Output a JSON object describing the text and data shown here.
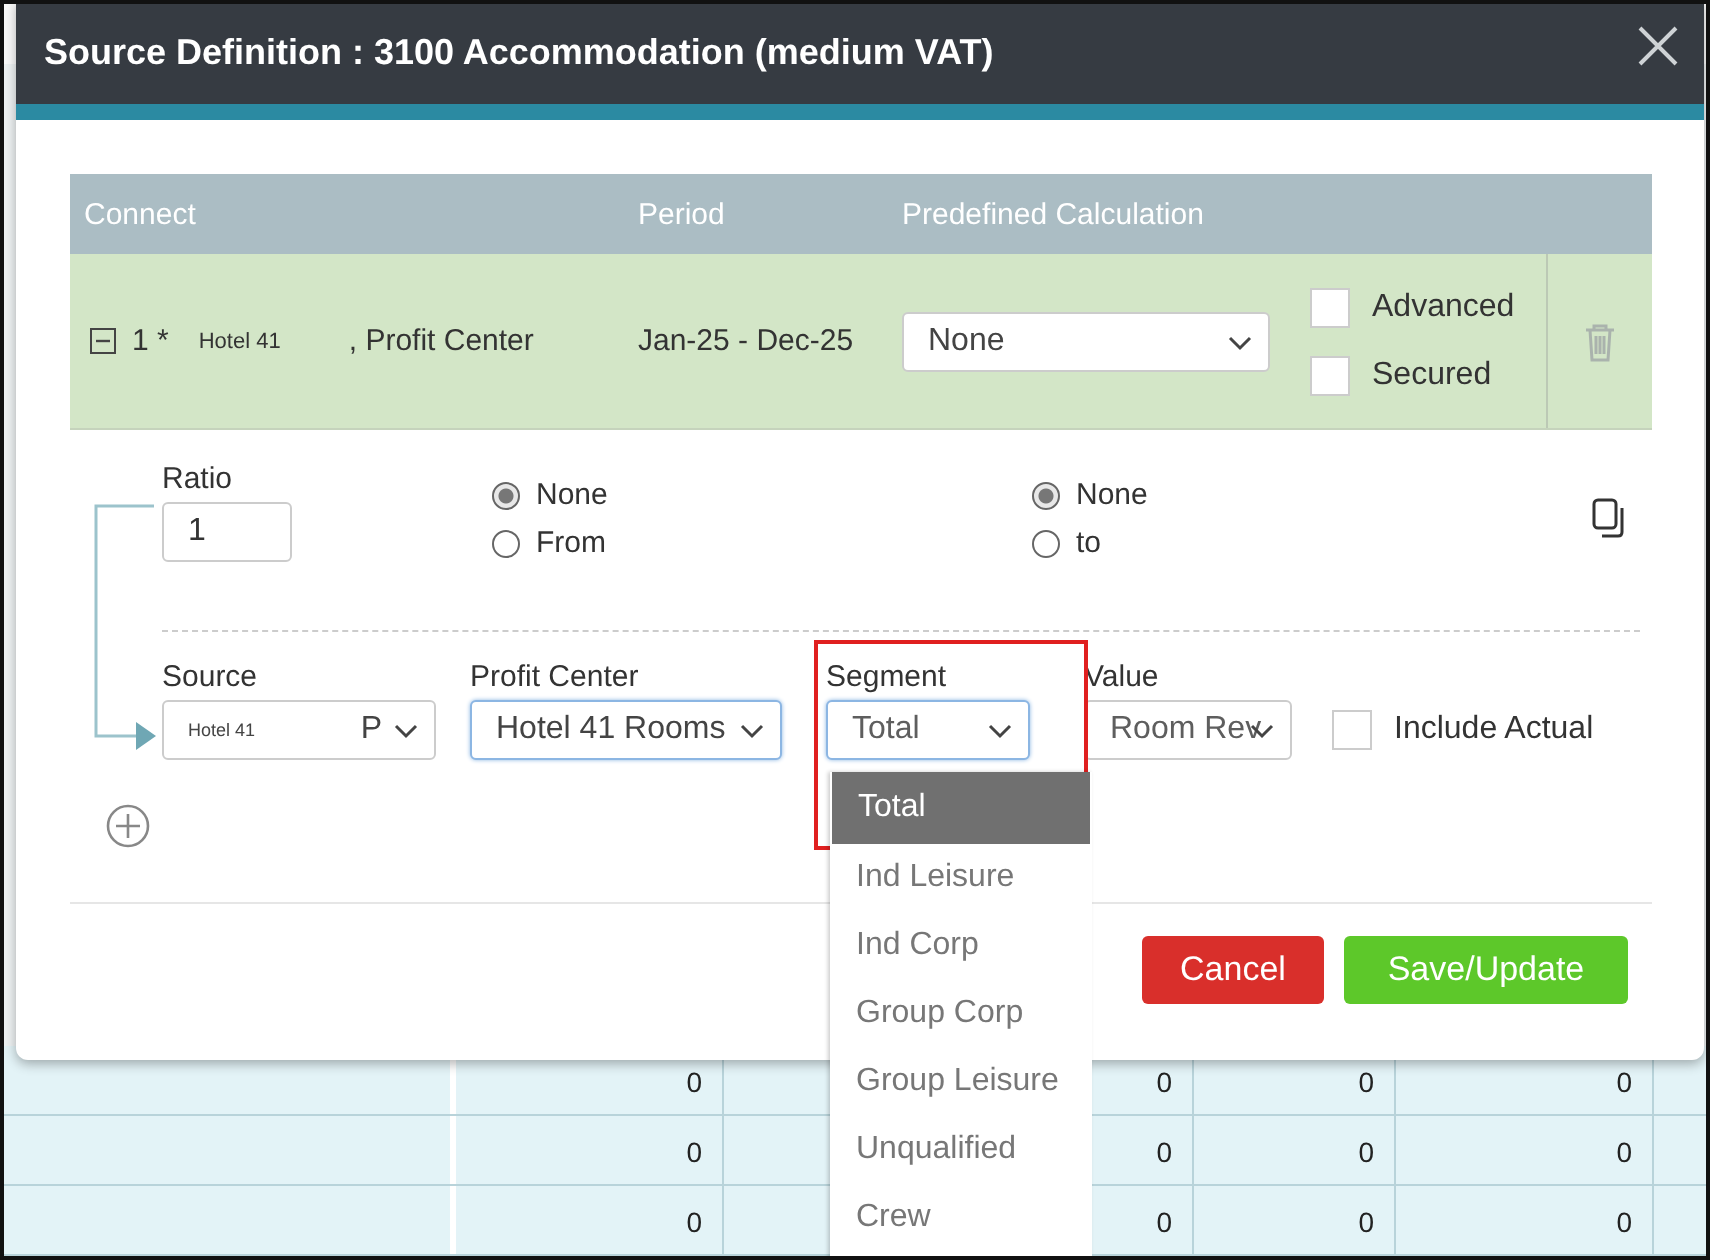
{
  "dialog": {
    "title": "Source Definition : 3100 Accommodation (medium VAT)"
  },
  "table": {
    "columns": [
      "Connect",
      "Period",
      "Predefined Calculation"
    ],
    "rows": [
      {
        "expanded": true,
        "index": "1 *",
        "source": "Hotel 41",
        "source_type": ", Profit Center",
        "period": "Jan-25 - Dec-25",
        "calculation": "None",
        "advanced": {
          "label": "Advanced",
          "checked": false
        },
        "secured": {
          "label": "Secured",
          "checked": false
        }
      }
    ]
  },
  "ratio": {
    "label": "Ratio",
    "value": "1",
    "from_options": [
      {
        "label": "None",
        "selected": true
      },
      {
        "label": "From",
        "selected": false
      }
    ],
    "to_options": [
      {
        "label": "None",
        "selected": true
      },
      {
        "label": "to",
        "selected": false
      }
    ]
  },
  "fields": {
    "source": {
      "label": "Source",
      "value": "Hotel 41",
      "suffix": "P"
    },
    "profit_center": {
      "label": "Profit Center",
      "value": "Hotel 41 Rooms"
    },
    "segment": {
      "label": "Segment",
      "value": "Total",
      "options": [
        {
          "label": "Total",
          "selected": true
        },
        {
          "label": "Ind Leisure",
          "selected": false
        },
        {
          "label": "Ind Corp",
          "selected": false
        },
        {
          "label": "Group Corp",
          "selected": false
        },
        {
          "label": "Group Leisure",
          "selected": false
        },
        {
          "label": "Unqualified",
          "selected": false
        },
        {
          "label": "Crew",
          "selected": false
        }
      ]
    },
    "value": {
      "label": "Value",
      "value": "Room Rev"
    },
    "include_actual": {
      "label": "Include Actual",
      "checked": false
    }
  },
  "buttons": {
    "cancel": "Cancel",
    "save": "Save/Update"
  },
  "background_table": {
    "rows": [
      {
        "cells": [
          "0",
          "0",
          "0",
          "0"
        ]
      },
      {
        "cells": [
          "0",
          "0",
          "0",
          "0"
        ]
      },
      {
        "cells": [
          "0",
          "0",
          "0",
          "0"
        ]
      }
    ]
  }
}
